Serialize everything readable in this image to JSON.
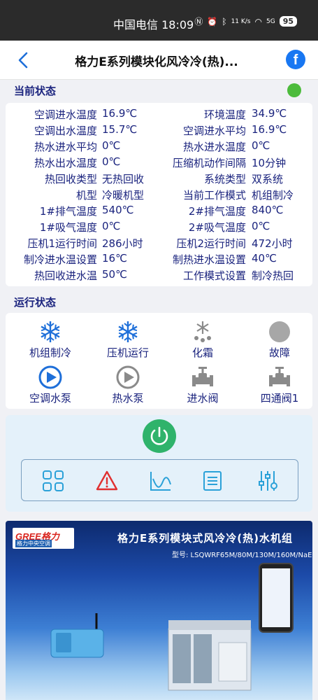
{
  "statusbar": {
    "carrier_time": "中国电信 18:09",
    "net": "11 K/s",
    "signal": "5G",
    "battery": "95"
  },
  "header": {
    "title": "格力E系列模块化风冷冷(热)...",
    "share_label": "f"
  },
  "current_status": {
    "title": "当前状态",
    "indicator_color": "#4cbb3c",
    "rows": [
      {
        "l1": "空调进水温度",
        "v1": "16.9℃",
        "l2": "环境温度",
        "v2": "34.9℃"
      },
      {
        "l1": "空调出水温度",
        "v1": "15.7℃",
        "l2": "空调进水平均",
        "v2": "16.9℃"
      },
      {
        "l1": "热水进水平均",
        "v1": "0℃",
        "l2": "热水进水温度",
        "v2": "0℃"
      },
      {
        "l1": "热水出水温度",
        "v1": "0℃",
        "l2": "压缩机动作间隔",
        "v2": "10分钟"
      },
      {
        "l1": "热回收类型",
        "v1": "无热回收",
        "l2": "系统类型",
        "v2": "双系统"
      },
      {
        "l1": "机型",
        "v1": "冷暖机型",
        "l2": "当前工作模式",
        "v2": "机组制冷"
      },
      {
        "l1": "1#排气温度",
        "v1": "540℃",
        "l2": "2#排气温度",
        "v2": "840℃"
      },
      {
        "l1": "1#吸气温度",
        "v1": "0℃",
        "l2": "2#吸气温度",
        "v2": "0℃"
      },
      {
        "l1": "压机1运行时间",
        "v1": "286小时",
        "l2": "压机2运行时间",
        "v2": "472小时"
      },
      {
        "l1": "制冷进水温设置",
        "v1": "16℃",
        "l2": "制热进水温设置",
        "v2": "40℃"
      },
      {
        "l1": "热回收进水温",
        "v1": "50℃",
        "l2": "工作模式设置",
        "v2": "制冷热回"
      }
    ]
  },
  "run_status": {
    "title": "运行状态",
    "items": [
      {
        "label": "机组制冷",
        "icon": "snowflake-icon",
        "active": true
      },
      {
        "label": "压机运行",
        "icon": "snowflake-icon",
        "active": true
      },
      {
        "label": "化霜",
        "icon": "defrost-icon",
        "active": false
      },
      {
        "label": "故障",
        "icon": "fault-icon",
        "active": false
      },
      {
        "label": "空调水泵",
        "icon": "pump-icon",
        "active": true
      },
      {
        "label": "热水泵",
        "icon": "pump-icon",
        "active": false
      },
      {
        "label": "进水阀",
        "icon": "valve-icon",
        "active": false
      },
      {
        "label": "四通阀1",
        "icon": "valve-icon",
        "active": false
      }
    ]
  },
  "controls": {
    "power_icon": "power-icon",
    "tools": [
      "grid-icon",
      "alarm-icon",
      "chart-icon",
      "list-icon",
      "settings-sliders-icon"
    ]
  },
  "banner": {
    "brand": "GREE格力",
    "brand_sub": "格力中央空调",
    "title": "格力E系列模块式风冷冷(热)水机组",
    "model": "型号: LSQWRF65M/80M/130M/160M/NaE"
  },
  "colors": {
    "text": "#1a237e",
    "active_icon": "#1e6fd9",
    "inactive_icon": "#8a8a8a",
    "power": "#2fb36b",
    "alarm": "#e03030"
  }
}
